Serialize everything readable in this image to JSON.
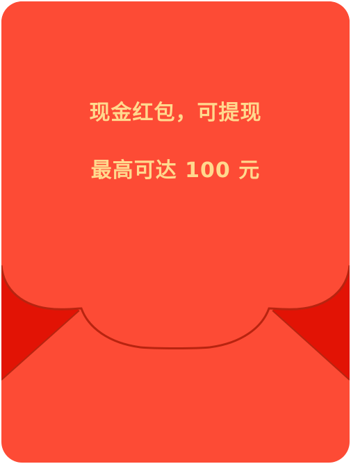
{
  "envelope": {
    "headline": "现金红包，可提现",
    "subline": "最高可达 100 元"
  },
  "colors": {
    "envelope_red": "#fd4b35",
    "flap_shadow_red": "#e21305",
    "outline_dark_red": "#b82410",
    "text_gold": "#ffd98e"
  }
}
